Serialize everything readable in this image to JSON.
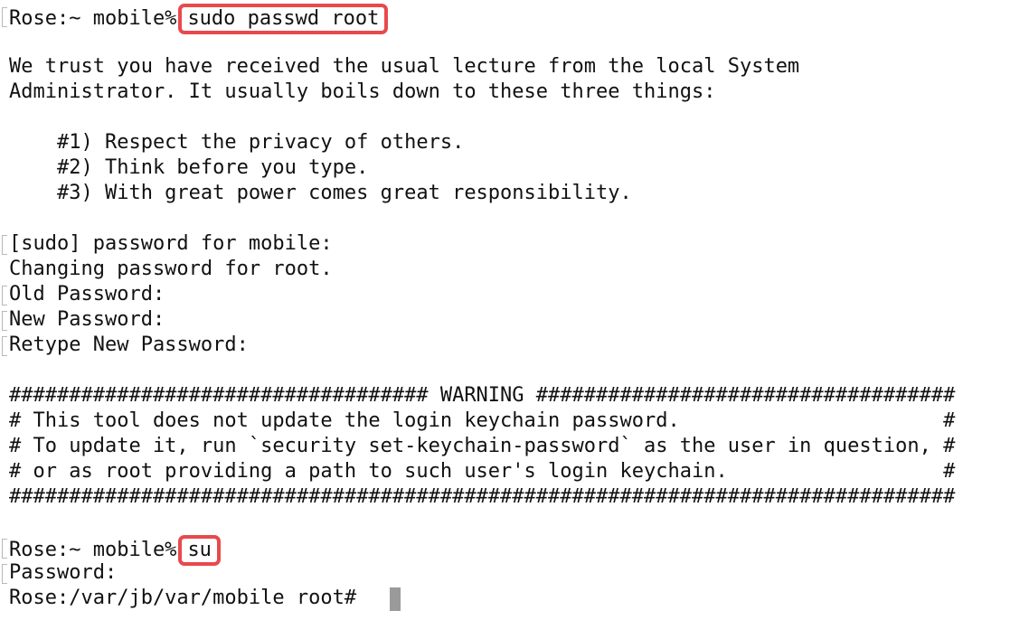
{
  "terminal": {
    "prompt_1": "Rose:~ mobile%",
    "command_1": "sudo passwd root",
    "lecture_1": "We trust you have received the usual lecture from the local System",
    "lecture_2": "Administrator. It usually boils down to these three things:",
    "rule_1": "    #1) Respect the privacy of others.",
    "rule_2": "    #2) Think before you type.",
    "rule_3": "    #3) With great power comes great responsibility.",
    "sudo_prompt": "[sudo] password for mobile:",
    "changing": "Changing password for root.",
    "old_password": "Old Password:",
    "new_password": "New Password:",
    "retype_password": "Retype New Password:",
    "warning_1": "################################### WARNING ###################################",
    "warning_2": "# This tool does not update the login keychain password.                      #",
    "warning_3": "# To update it, run `security set-keychain-password` as the user in question, #",
    "warning_4": "# or as root providing a path to such user's login keychain.                  #",
    "warning_5": "###############################################################################",
    "prompt_2": "Rose:~ mobile%",
    "command_2": "su",
    "password_prompt": "Password:",
    "root_prompt": "Rose:/var/jb/var/mobile root#"
  },
  "colors": {
    "highlight": "#e8494d",
    "cursor": "#9a9a9a",
    "text": "#111111",
    "background": "#ffffff"
  }
}
